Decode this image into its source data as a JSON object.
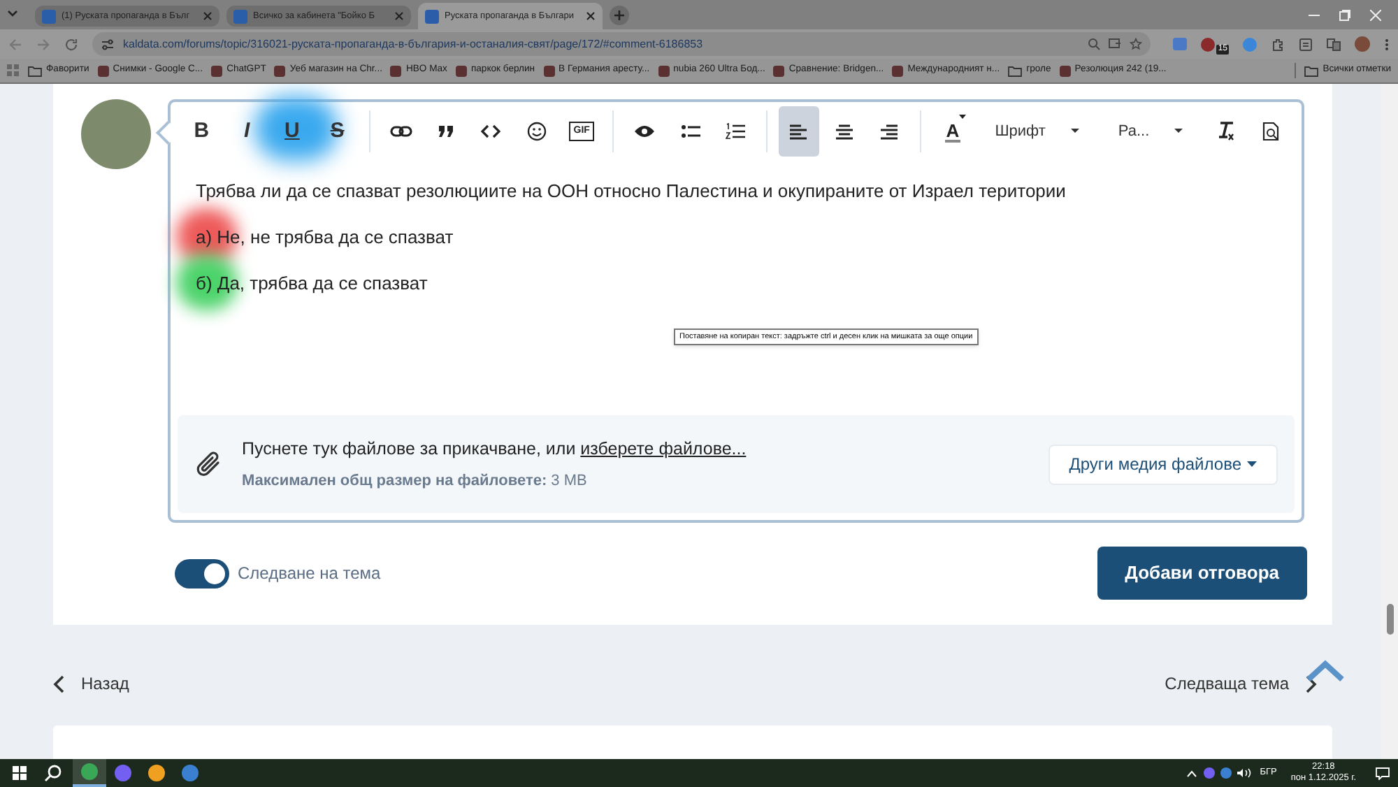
{
  "browser": {
    "tabs": [
      {
        "title": "(1) Руската пропаганда в Бълг",
        "selected": false
      },
      {
        "title": "Всичко за кабинета \"Бойко Б",
        "selected": false
      },
      {
        "title": "Руската пропаганда в Българи",
        "selected": true
      }
    ],
    "url": "kaldata.com/forums/topic/316021-руската-пропаганда-в-българия-и-останалия-свят/page/172/#comment-6186853",
    "extension_badge": "15",
    "bookmarks": [
      {
        "label": "Фаворити",
        "kind": "folder"
      },
      {
        "label": "Снимки - Google С...",
        "kind": "site"
      },
      {
        "label": "ChatGPT",
        "kind": "site"
      },
      {
        "label": "Уеб магазин на Chr...",
        "kind": "site"
      },
      {
        "label": "HBO Max",
        "kind": "site"
      },
      {
        "label": "паркок берлин",
        "kind": "site"
      },
      {
        "label": "В Германия аресту...",
        "kind": "site"
      },
      {
        "label": "nubia 260 Ultra Бод...",
        "kind": "site"
      },
      {
        "label": "Сравнение: Bridgen...",
        "kind": "site"
      },
      {
        "label": "Международният н...",
        "kind": "site"
      },
      {
        "label": "гроле",
        "kind": "folder"
      },
      {
        "label": "Резолюция 242 (19...",
        "kind": "site"
      }
    ],
    "all_bookmarks": "Всички отметки"
  },
  "editor": {
    "toolbar": [
      {
        "kind": "bold",
        "label": "B"
      },
      {
        "kind": "italic",
        "label": "I"
      },
      {
        "kind": "underline",
        "label": "U"
      },
      {
        "kind": "strike",
        "label": "S"
      },
      {
        "kind": "separator"
      },
      {
        "kind": "link"
      },
      {
        "kind": "quote"
      },
      {
        "kind": "code"
      },
      {
        "kind": "emoji"
      },
      {
        "kind": "gif",
        "label": "GIF"
      },
      {
        "kind": "separator"
      },
      {
        "kind": "preview"
      },
      {
        "kind": "bullets"
      },
      {
        "kind": "numbered"
      },
      {
        "kind": "separator"
      },
      {
        "kind": "align-left",
        "selected": true
      },
      {
        "kind": "align-center",
        "selected": false
      },
      {
        "kind": "align-right",
        "selected": false
      },
      {
        "kind": "separator"
      },
      {
        "kind": "color",
        "label": "A"
      },
      {
        "kind": "dropdown",
        "label": "Шрифт"
      },
      {
        "kind": "dropdown",
        "label": "Ра..."
      },
      {
        "kind": "clear-format"
      },
      {
        "kind": "source"
      }
    ],
    "paragraphs": [
      {
        "text": "Трябва ли да се спазват резолюциите на ООН относно Палестина и окупираните от Израел територии"
      },
      {
        "text": "а) Не, не трябва да се спазват"
      },
      {
        "text": "б) Да, трябва да се спазват"
      }
    ],
    "tooltip": "Поставяне на копиран текст: задръжте ctrl и десен клик на мишката за още опции",
    "attachments": {
      "prompt": "Пуснете тук файлове за прикачване, или ",
      "link": "изберете файлове...",
      "limit": "**Максимален общ размер на файловете:** 3 MB",
      "media_button": "Други медия файлове"
    }
  },
  "follow": {
    "label": "Следване на тема",
    "on": true
  },
  "submit": "Добави отговора",
  "nav": {
    "back": "Назад",
    "next": "Следваща тема"
  },
  "taskbar": {
    "apps": [
      {
        "kind": "chrome",
        "selected": true
      },
      {
        "kind": "viber",
        "selected": false
      },
      {
        "kind": "chrome-alt",
        "selected": false
      },
      {
        "kind": "qbit",
        "selected": false
      }
    ],
    "language": "БГР",
    "time": "22:18",
    "date": "пон 1.12.2025 г."
  }
}
